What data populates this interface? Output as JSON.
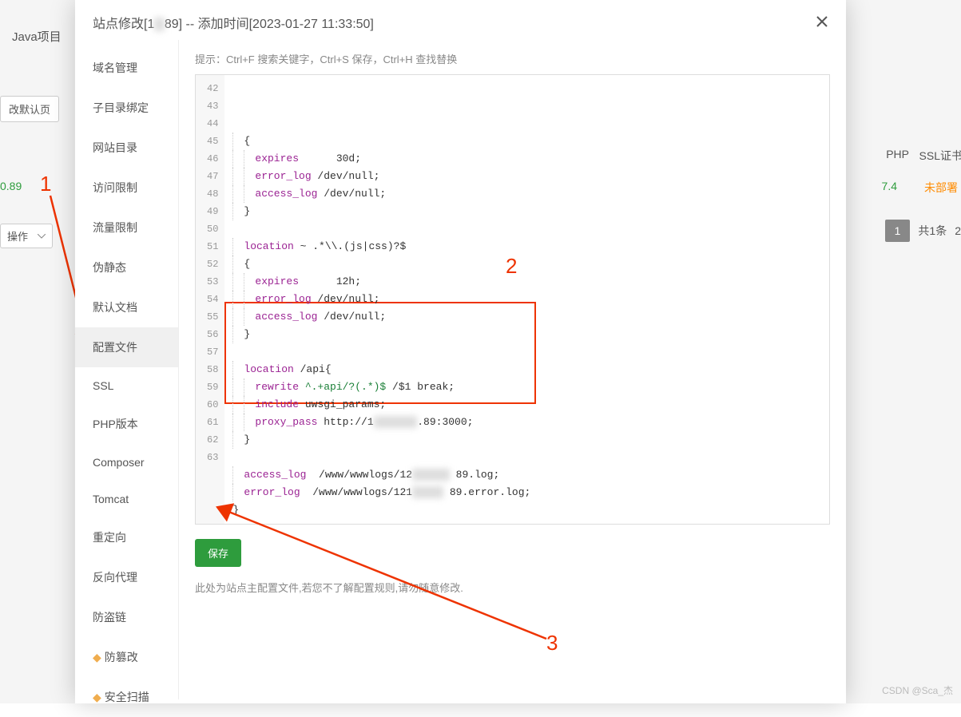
{
  "background": {
    "javaTab": "Java项目",
    "defaultBtn": "改默认页",
    "siteIp": "0.89",
    "annotation1": "1",
    "operationSelect": "操作",
    "phpHeader": "PHP",
    "sslHeader": "SSL证书",
    "phpValue": "7.4",
    "sslValue": "未部署",
    "pagerOne": "1",
    "pagerTotal": "共1条",
    "pagerExtra": "2",
    "watermark": "CSDN @Sca_杰"
  },
  "modal": {
    "titlePrefix": "站点修改[1",
    "titleBlurred": "        ",
    "titleSuffix": "89] -- 添加时间[2023-01-27 11:33:50]",
    "hint": "提示：Ctrl+F 搜索关键字，Ctrl+S 保存，Ctrl+H 查找替换",
    "saveBtn": "保存",
    "warning": "此处为站点主配置文件,若您不了解配置规则,请勿随意修改."
  },
  "sidebar": {
    "items": [
      {
        "label": "域名管理"
      },
      {
        "label": "子目录绑定"
      },
      {
        "label": "网站目录"
      },
      {
        "label": "访问限制"
      },
      {
        "label": "流量限制"
      },
      {
        "label": "伪静态"
      },
      {
        "label": "默认文档"
      },
      {
        "label": "配置文件",
        "active": true
      },
      {
        "label": "SSL"
      },
      {
        "label": "PHP版本"
      },
      {
        "label": "Composer"
      },
      {
        "label": "Tomcat"
      },
      {
        "label": "重定向"
      },
      {
        "label": "反向代理"
      },
      {
        "label": "防盗链"
      },
      {
        "label": "防篡改",
        "icon": "diamond"
      },
      {
        "label": "安全扫描",
        "icon": "diamond"
      }
    ]
  },
  "annotations": {
    "red2": "2",
    "red3": "3"
  },
  "editor": {
    "startLine": 42,
    "lines": [
      {
        "i": 1,
        "tokens": [
          {
            "t": "{",
            "c": "sel"
          }
        ]
      },
      {
        "i": 2,
        "tokens": [
          {
            "t": "expires",
            "c": "kw"
          },
          {
            "t": "      30d;",
            "c": "str"
          }
        ]
      },
      {
        "i": 2,
        "tokens": [
          {
            "t": "error_log",
            "c": "kw"
          },
          {
            "t": " /dev/null;",
            "c": "str"
          }
        ]
      },
      {
        "i": 2,
        "tokens": [
          {
            "t": "access_log",
            "c": "kw"
          },
          {
            "t": " /dev/null;",
            "c": "str"
          }
        ]
      },
      {
        "i": 1,
        "tokens": [
          {
            "t": "}",
            "c": "sel"
          }
        ]
      },
      {
        "i": 0,
        "tokens": []
      },
      {
        "i": 1,
        "tokens": [
          {
            "t": "location",
            "c": "kw"
          },
          {
            "t": " ~ .*\\\\.(js|css)?$",
            "c": "sel"
          }
        ]
      },
      {
        "i": 1,
        "tokens": [
          {
            "t": "{",
            "c": "sel"
          }
        ]
      },
      {
        "i": 2,
        "tokens": [
          {
            "t": "expires",
            "c": "kw"
          },
          {
            "t": "      12h;",
            "c": "str"
          }
        ]
      },
      {
        "i": 2,
        "tokens": [
          {
            "t": "error_log",
            "c": "kw"
          },
          {
            "t": " /dev/null;",
            "c": "str"
          }
        ]
      },
      {
        "i": 2,
        "tokens": [
          {
            "t": "access_log",
            "c": "kw"
          },
          {
            "t": " /dev/null;",
            "c": "str"
          }
        ]
      },
      {
        "i": 1,
        "tokens": [
          {
            "t": "}",
            "c": "sel"
          }
        ]
      },
      {
        "i": 0,
        "tokens": []
      },
      {
        "i": 1,
        "tokens": [
          {
            "t": "location",
            "c": "kw"
          },
          {
            "t": " /api{",
            "c": "sel"
          }
        ]
      },
      {
        "i": 2,
        "tokens": [
          {
            "t": "rewrite",
            "c": "kw"
          },
          {
            "t": " ^.+api/?(.*)$",
            "c": "num"
          },
          {
            "t": " /$1 break;",
            "c": "str"
          }
        ]
      },
      {
        "i": 2,
        "tokens": [
          {
            "t": "include",
            "c": "kw"
          },
          {
            "t": " uwsgi_params;",
            "c": "str"
          }
        ]
      },
      {
        "i": 2,
        "tokens": [
          {
            "t": "proxy_pass",
            "c": "kw"
          },
          {
            "t": " http://1",
            "c": "str"
          },
          {
            "t": "       ",
            "c": "blurtxt"
          },
          {
            "t": ".89:3000;",
            "c": "str"
          }
        ]
      },
      {
        "i": 1,
        "tokens": [
          {
            "t": "}",
            "c": "sel"
          }
        ]
      },
      {
        "i": 0,
        "tokens": []
      },
      {
        "i": 1,
        "tokens": [
          {
            "t": "access_log",
            "c": "kw"
          },
          {
            "t": "  /www/wwwlogs/12",
            "c": "str"
          },
          {
            "t": "      ",
            "c": "blurtxt"
          },
          {
            "t": " 89.log;",
            "c": "str"
          }
        ]
      },
      {
        "i": 1,
        "tokens": [
          {
            "t": "error_log",
            "c": "kw"
          },
          {
            "t": "  /www/wwwlogs/121",
            "c": "str"
          },
          {
            "t": "     ",
            "c": "blurtxt"
          },
          {
            "t": " 89.error.log;",
            "c": "str"
          }
        ]
      },
      {
        "i": 0,
        "tokens": [
          {
            "t": "}",
            "c": "sel"
          }
        ]
      }
    ]
  }
}
